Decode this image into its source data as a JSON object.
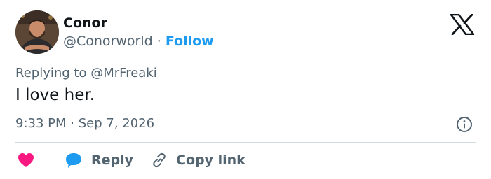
{
  "author": {
    "name": "Conor",
    "handle": "@Conorworld",
    "separator": "·",
    "follow_label": "Follow"
  },
  "tweet": {
    "replying_prefix": "Replying to",
    "replying_to": "@MrFreaki",
    "text": "I love her.",
    "time": "9:33 PM",
    "date_separator": "·",
    "date": "Sep 7, 2026"
  },
  "actions": {
    "reply_label": "Reply",
    "copy_link_label": "Copy link"
  },
  "icons": {
    "brand": "x-logo-icon",
    "info": "info-icon",
    "like": "heart-icon",
    "reply": "speech-bubble-icon",
    "copy": "link-icon"
  },
  "colors": {
    "text": "#0f1419",
    "secondary": "#536471",
    "accent": "#1d9bf0",
    "like": "#f91880",
    "divider": "#cfd9de"
  }
}
